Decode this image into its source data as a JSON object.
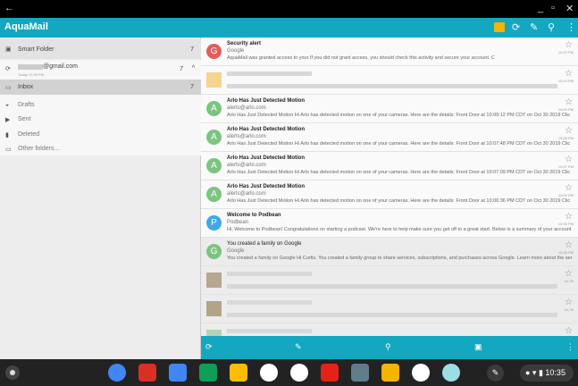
{
  "app": {
    "title": "AquaMail",
    "accent": "#13a8bf"
  },
  "window": {
    "back": "←",
    "minimize": "_",
    "maximize": "▫",
    "close": "✕"
  },
  "toolbar": {
    "icons": [
      "calendar-icon",
      "refresh-icon",
      "compose-icon",
      "search-icon",
      "more-icon"
    ]
  },
  "sidebar": {
    "smart_folder": {
      "label": "Smart Folder",
      "count": "7"
    },
    "account": {
      "email": "@gmail.com",
      "sync": "Today 12:35 PM",
      "count": "7"
    },
    "folders": [
      {
        "label": "Inbox",
        "count": "7",
        "icon": "inbox-icon"
      },
      {
        "label": "Drafts",
        "count": "",
        "icon": "drafts-icon"
      },
      {
        "label": "Sent",
        "count": "",
        "icon": "sent-icon"
      },
      {
        "label": "Deleted",
        "count": "",
        "icon": "trash-icon"
      },
      {
        "label": "Other folders...",
        "count": "",
        "icon": "folder-icon"
      }
    ]
  },
  "messages": [
    {
      "initial": "G",
      "color": "#e35d5b",
      "subject": "Security alert",
      "from": "Google",
      "preview": "AquaMail was granted access to your                                             If you did not grant access, you should check this activity and secure your account. C",
      "time": "10:20 PM",
      "read": false,
      "blurred": false
    },
    {
      "initial": "",
      "color": "#f3c35e",
      "subject": "",
      "from": "",
      "preview": "",
      "time": "10:19 PM",
      "read": false,
      "blurred": true
    },
    {
      "initial": "A",
      "color": "#7cc47f",
      "subject": "Arlo Has Just Detected Motion",
      "from": "alerts@arlo.com",
      "preview": "Arlo Has Just Detected Motion Hi          Arlo has detected motion on one of your cameras. Here are the details: Front Door at 10:09:12 PM CDT on Oct 30 2019 Clic",
      "time": "10:09 PM",
      "read": false,
      "blurred": false
    },
    {
      "initial": "A",
      "color": "#7cc47f",
      "subject": "Arlo Has Just Detected Motion",
      "from": "alerts@arlo.com",
      "preview": "Arlo Has Just Detected Motion Hi          Arlo has detected motion on one of your cameras. Here are the details: Front Door at 10:07:48 PM CDT on Oct 30 2019 Clic",
      "time": "10:08 PM",
      "read": false,
      "blurred": false
    },
    {
      "initial": "A",
      "color": "#7cc47f",
      "subject": "Arlo Has Just Detected Motion",
      "from": "alerts@arlo.com",
      "preview": "Arlo Has Just Detected Motion Hi          Arlo has detected motion on one of your cameras. Here are the details: Front Door at 10:07:09 PM CDT on Oct 30 2019 Clic",
      "time": "10:07 PM",
      "read": false,
      "blurred": false
    },
    {
      "initial": "A",
      "color": "#7cc47f",
      "subject": "Arlo Has Just Detected Motion",
      "from": "alerts@arlo.com",
      "preview": "Arlo Has Just Detected Motion Hi          Arlo has detected motion on one of your cameras. Here are the details: Front Door at 10:06:36 PM CDT on Oct 30 2019 Clic",
      "time": "10:06 PM",
      "read": false,
      "blurred": false
    },
    {
      "initial": "P",
      "color": "#3fa9e6",
      "subject": "Welcome to Podbean",
      "from": "Podbean",
      "preview": "Hi, Welcome to Podbean! Congratulations on starting a podcast. We're here to help make sure you get off to a great start. Below is a summary of your account infor",
      "time": "10:05 PM",
      "read": false,
      "blurred": false
    },
    {
      "initial": "G",
      "color": "#7cc47f",
      "subject": "You created a family on Google",
      "from": "Google",
      "preview": "You created a family on Google Hi Curtis, You created a family group to share services, subscriptions, and purchases across Google. Learn more about the services",
      "time": "10:05 PM",
      "read": true,
      "blurred": false
    },
    {
      "initial": "",
      "color": "#a08a6a",
      "subject": "",
      "from": "",
      "preview": "",
      "time": "Jul 29",
      "read": true,
      "blurred": true
    },
    {
      "initial": "",
      "color": "#9a8560",
      "subject": "",
      "from": "",
      "preview": "",
      "time": "Jul 29",
      "read": true,
      "blurred": true
    },
    {
      "initial": "",
      "color": "#9cc99c",
      "subject": "",
      "from": "",
      "preview": "",
      "time": "",
      "read": true,
      "blurred": true
    }
  ],
  "bottom_toolbar": {
    "icons": [
      "refresh-icon",
      "compose-icon",
      "search-icon",
      "select-icon",
      "more-icon"
    ]
  },
  "shelf": {
    "apps": [
      "Chrome",
      "Gmail",
      "Docs",
      "Sheets",
      "Drive",
      "Photos",
      "Play Store",
      "YouTube",
      "Calculator",
      "Keep",
      "Info",
      "AquaMail"
    ],
    "time": "10:35"
  }
}
